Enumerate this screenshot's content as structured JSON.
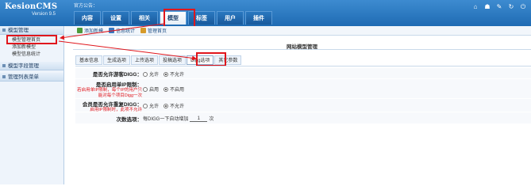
{
  "app": {
    "name": "KesionCMS",
    "version": "Version 9.5"
  },
  "notice": "官方公告：",
  "tabs": [
    {
      "label": "内容"
    },
    {
      "label": "设置"
    },
    {
      "label": "相关"
    },
    {
      "label": "模型",
      "active": true
    },
    {
      "label": "标签"
    },
    {
      "label": "用户"
    },
    {
      "label": "插件"
    }
  ],
  "top_icons": [
    "home-icon",
    "user-icon",
    "wrench-icon",
    "refresh-icon",
    "power-icon"
  ],
  "sidebar": {
    "sections": [
      {
        "title": "模型管理",
        "items": [
          "模型管理首页",
          "添加新模型",
          "模型信息统计"
        ]
      },
      {
        "title": "模型字段管理",
        "items": []
      },
      {
        "title": "管理列表菜单",
        "items": []
      }
    ]
  },
  "toolbar": {
    "buttons": [
      "添加新模",
      "信息统计",
      "管理首页"
    ]
  },
  "panel": {
    "title": "网站模型管理"
  },
  "subtabs": [
    "基本信息",
    "生成选项",
    "上传选项",
    "投稿选项",
    "Digg选项",
    "其它参数"
  ],
  "form": {
    "row1": {
      "label": "是否允许游客DIGG：",
      "opt_yes": "允许",
      "opt_no": "不允许"
    },
    "row2": {
      "label": "是否启用单IP限制：",
      "hint": "若启用单IP限制，每个IP的用户只能对每个项目Digg一次",
      "opt_yes": "启用",
      "opt_no": "不启用"
    },
    "row3": {
      "label": "会员是否允许重复DIGG：",
      "hint": "启用IP限制时，此项不允许",
      "opt_yes": "允许",
      "opt_no": "不允许"
    },
    "row4": {
      "label": "次数选项：",
      "prefix": "每DIGG一下自动增加",
      "value": "1",
      "suffix": "次"
    }
  },
  "colors": {
    "topbar": "#1f6bb3",
    "highlight": "#e0161c",
    "hint": "#e0161c"
  }
}
